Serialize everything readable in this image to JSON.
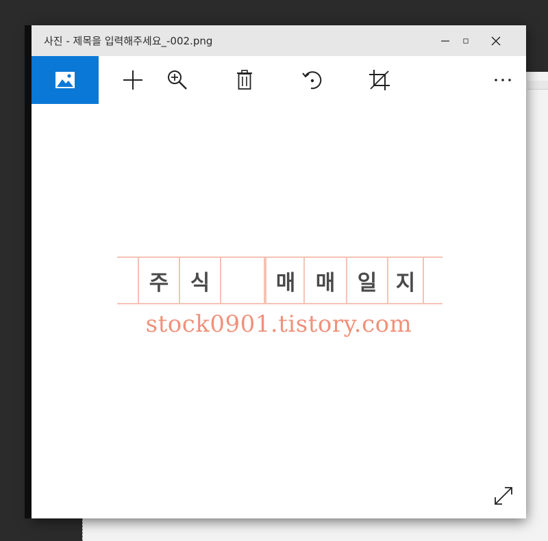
{
  "window": {
    "title": "사진 - 제목을 입력해주세요_-002.png"
  },
  "titlebar_buttons": [
    "minimize-icon",
    "maximize-icon",
    "close-icon"
  ],
  "toolbar": {
    "items": [
      {
        "name": "photo-view-icon",
        "active": true
      },
      {
        "name": "add-icon"
      },
      {
        "name": "zoom-in-icon"
      },
      {
        "name": "delete-icon"
      },
      {
        "name": "rotate-icon"
      },
      {
        "name": "crop-icon"
      },
      {
        "name": "more-options-icon"
      }
    ],
    "active_color": "#0a78d7"
  },
  "image": {
    "cells": [
      "",
      "주",
      "식",
      "",
      "매",
      "매",
      "일",
      "지",
      ""
    ],
    "url_text": "stock0901.tistory.com",
    "url_color": "#f0917a",
    "line_color": "#f4c3b3",
    "char_color": "#4a4a4a"
  },
  "viewer": {
    "expand_icon": "expand-icon"
  }
}
